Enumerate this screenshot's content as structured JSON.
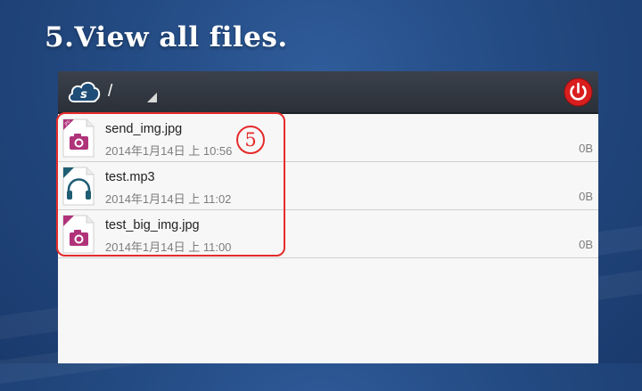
{
  "headline": "5.View all files.",
  "toolbar": {
    "path": "/"
  },
  "files": [
    {
      "name": "send_img.jpg",
      "date": "2014年1月14日 上 10:56",
      "size": "0B",
      "type_label": "JPG",
      "icon": "camera-icon",
      "color": "#b0337a"
    },
    {
      "name": "test.mp3",
      "date": "2014年1月14日 上 11:02",
      "size": "0B",
      "type_label": "MP3",
      "icon": "headphones-icon",
      "color": "#1f5d73"
    },
    {
      "name": "test_big_img.jpg",
      "date": "2014年1月14日 上 11:00",
      "size": "0B",
      "type_label": "JPG",
      "icon": "camera-icon",
      "color": "#b0337a"
    }
  ],
  "annotation": {
    "step": "5"
  },
  "colors": {
    "annotation": "#e52b2b",
    "power": "#d91e1e",
    "logo": "#1f4d78"
  }
}
